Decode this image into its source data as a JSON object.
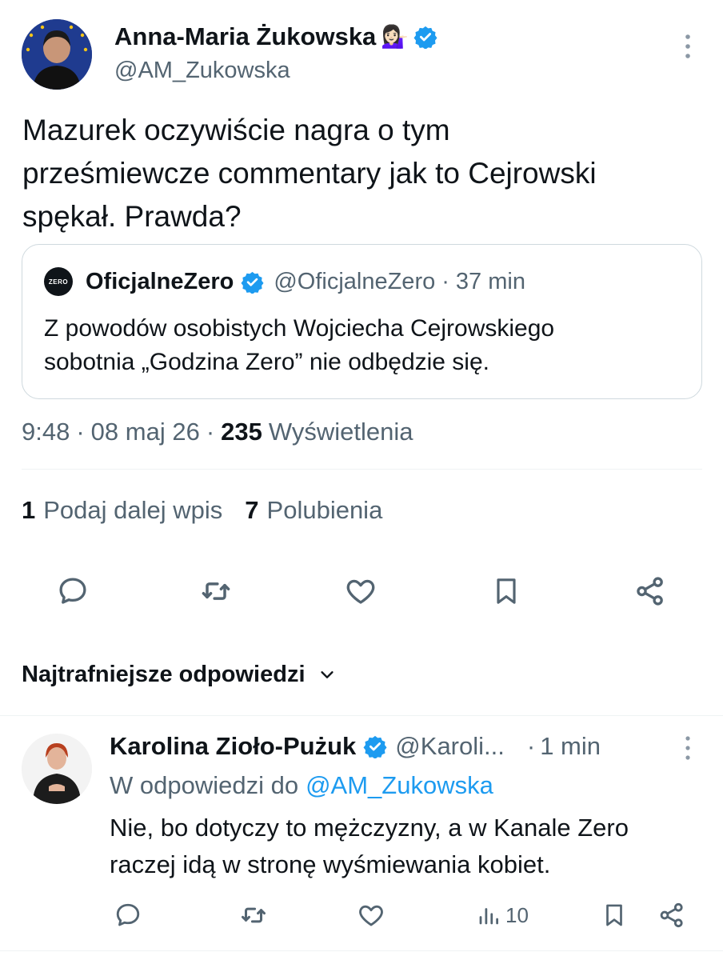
{
  "tweet": {
    "author_name": "Anna-Maria Żukowska",
    "author_handle": "@AM_Zukowska",
    "emoji": "💁🏻‍♀️",
    "text_line1": "Mazurek oczywiście nagra o tym",
    "text_line2": "prześmiewcze commentary jak to Cejrowski",
    "text_line3": "spękał. Prawda?",
    "time": "9:48",
    "date": "08 maj 26",
    "views_count": "235",
    "views_label": "Wyświetlenia",
    "reposts_count": "1",
    "reposts_label": "Podaj dalej wpis",
    "likes_count": "7",
    "likes_label": "Polubienia"
  },
  "quote": {
    "avatar_text": "ZERO",
    "name": "OficjalneZero",
    "handle": "@OficjalneZero",
    "sep": "·",
    "time": "37 min",
    "text_line1": "Z powodów osobistych Wojciecha Cejrowskiego",
    "text_line2": "sobotnia „Godzina Zero” nie odbędzie się."
  },
  "sep": "·",
  "replies_header": {
    "label": "Najtrafniejsze odpowiedzi"
  },
  "reply": {
    "author_name": "Karolina Zioło-Pużuk",
    "author_handle": "@Karoli...",
    "sep": "·",
    "time": "1 min",
    "reply_to_prefix": "W odpowiedzi do",
    "reply_to_handle": "@AM_Zukowska",
    "text_line1": "Nie, bo dotyczy to mężczyzny, a w Kanale Zero",
    "text_line2": "raczej idą w stronę wyśmiewania kobiet.",
    "views": "10"
  },
  "colors": {
    "accent": "#1d9bf0",
    "secondary_text": "#536471",
    "primary_text": "#0f1419",
    "divider": "#eff3f4"
  }
}
